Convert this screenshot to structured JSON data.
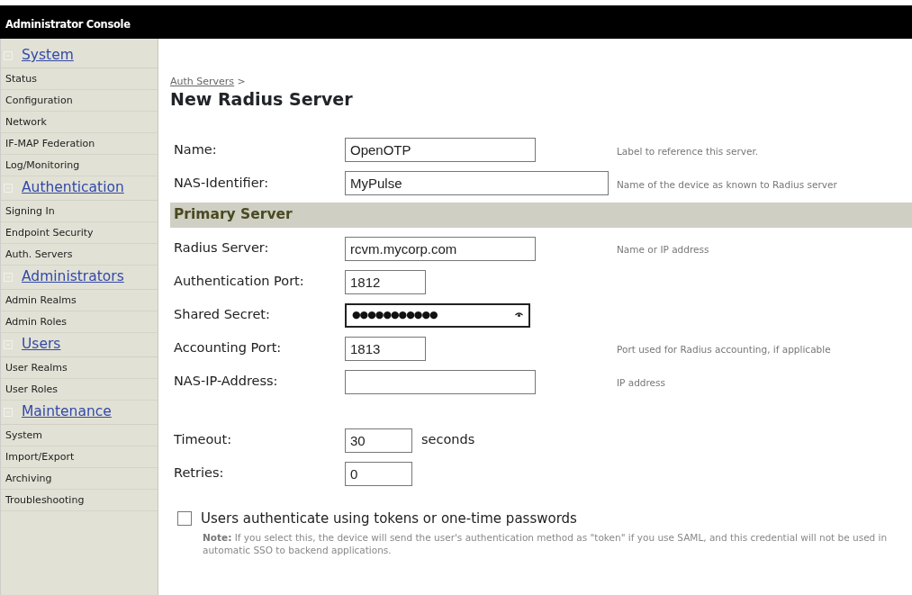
{
  "window": {
    "title": "Administrator Console"
  },
  "sidebar": {
    "sections": [
      {
        "title": "System",
        "items": [
          "Status",
          "Configuration",
          "Network",
          "IF-MAP Federation",
          "Log/Monitoring"
        ]
      },
      {
        "title": "Authentication",
        "items": [
          "Signing In",
          "Endpoint Security",
          "Auth. Servers"
        ]
      },
      {
        "title": "Administrators",
        "items": [
          "Admin Realms",
          "Admin Roles"
        ]
      },
      {
        "title": "Users",
        "items": [
          "User Realms",
          "User Roles"
        ]
      },
      {
        "title": "Maintenance",
        "items": [
          "System",
          "Import/Export",
          "Archiving",
          "Troubleshooting"
        ]
      }
    ]
  },
  "breadcrumb": {
    "link": "Auth Servers",
    "separator": ">"
  },
  "page_title": "New Radius Server",
  "groups": [
    {
      "kind": "plain",
      "fields": [
        {
          "kind": "text",
          "label": "Name:",
          "value": "OpenOTP",
          "hint": "Label to reference this server."
        },
        {
          "kind": "text",
          "label": "NAS-Identifier:",
          "value": "MyPulse",
          "hint": "Name of the device as known to Radius server"
        }
      ]
    },
    {
      "kind": "section",
      "title": "Primary Server",
      "fields": [
        {
          "kind": "text",
          "label": "Radius Server:",
          "value": "rcvm.mycorp.com",
          "hint": "Name or IP address"
        },
        {
          "kind": "text",
          "label": "Authentication Port:",
          "value": "1812"
        },
        {
          "kind": "password",
          "label": "Shared Secret:",
          "value": "●●●●●●●●●●●"
        },
        {
          "kind": "text",
          "label": "Accounting Port:",
          "value": "1813",
          "hint": "Port used for Radius accounting, if applicable"
        },
        {
          "kind": "text",
          "label": "NAS-IP-Address:",
          "hint": "IP address"
        }
      ]
    },
    {
      "kind": "spaced",
      "fields": [
        {
          "kind": "text",
          "label": "Timeout:",
          "value": "30",
          "suffix": "seconds"
        },
        {
          "kind": "text",
          "label": "Retries:",
          "value": "0"
        }
      ]
    }
  ],
  "option": {
    "label": "Users authenticate using tokens or one-time passwords",
    "checked": false,
    "note": "**Note:** If you select this, the device will send the user's authentication method as \"token\" if you use SAML, and this credential will not be used in automatic SSO to backend applications."
  }
}
